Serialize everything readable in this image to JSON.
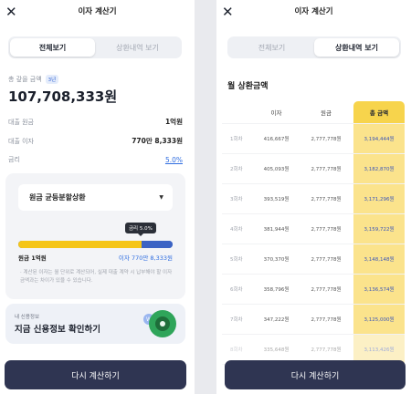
{
  "left": {
    "header_title": "이자 계산기",
    "close_glyph": "✕",
    "tabs": [
      {
        "label": "전체보기",
        "active": true
      },
      {
        "label": "상환내역 보기",
        "active": false
      }
    ],
    "total": {
      "label": "총 갚을 금액",
      "badge": "3년",
      "amount": "107,708,333원"
    },
    "details": [
      {
        "label": "대출 원금",
        "value": "1억원"
      },
      {
        "label": "대출 이자",
        "value": "770만 8,333원"
      },
      {
        "label": "금리",
        "value": "5.0%"
      }
    ],
    "repayment_method": "원금 균등분할상환",
    "tooltip": "금리 5.0%",
    "principal_share": 0.8,
    "principal_legend": "원금 1억원",
    "interest_legend": "이자 770만 8,333원",
    "note": "· 계산된 이자는 월 단위로 계산되어, 실제 대출 계약 시 납부해야 할 이자금액과는 차이가 있을 수 있습니다.",
    "credit": {
      "sub": "내 신용정보",
      "main": "지금 신용정보 확인하기",
      "w_glyph": "W"
    },
    "cta": "다시 계산하기",
    "colors": {
      "principal": "#f5c518",
      "interest": "#3b63c4",
      "cta": "#2f3552"
    }
  },
  "right": {
    "header_title": "이자 계산기",
    "close_glyph": "✕",
    "tabs": [
      {
        "label": "전체보기",
        "active": false
      },
      {
        "label": "상환내역 보기",
        "active": true
      }
    ],
    "section_title": "월 상환금액",
    "table": {
      "headers": [
        "",
        "이자",
        "원금",
        "총 금액"
      ],
      "rows": [
        [
          "1회차",
          "416,667원",
          "2,777,778원",
          "3,194,444원"
        ],
        [
          "2회차",
          "405,093원",
          "2,777,778원",
          "3,182,870원"
        ],
        [
          "3회차",
          "393,519원",
          "2,777,778원",
          "3,171,296원"
        ],
        [
          "4회차",
          "381,944원",
          "2,777,778원",
          "3,159,722원"
        ],
        [
          "5회차",
          "370,370원",
          "2,777,778원",
          "3,148,148원"
        ],
        [
          "6회차",
          "358,796원",
          "2,777,778원",
          "3,136,574원"
        ],
        [
          "7회차",
          "347,222원",
          "2,777,778원",
          "3,125,000원"
        ],
        [
          "8회차",
          "335,648원",
          "2,777,778원",
          "3,113,426원"
        ]
      ]
    },
    "cta": "다시 계산하기",
    "colors": {
      "highlight_column": "#fbe38c",
      "highlight_header": "#f7d44c"
    }
  }
}
